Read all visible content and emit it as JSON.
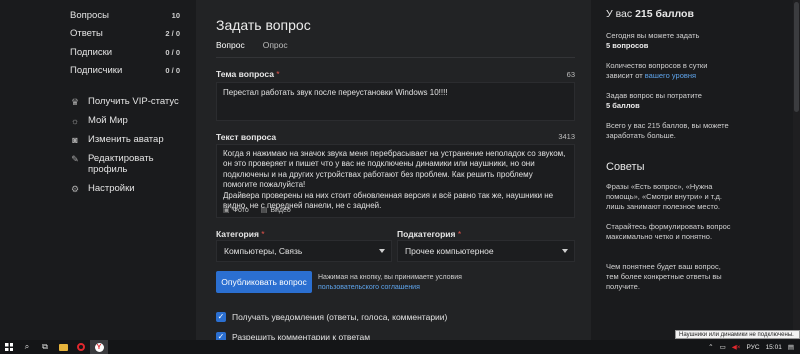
{
  "sidebar": {
    "stats": [
      {
        "label": "Вопросы",
        "count": "10"
      },
      {
        "label": "Ответы",
        "count": "2 / 0"
      },
      {
        "label": "Подписки",
        "count": "0 / 0"
      },
      {
        "label": "Подписчики",
        "count": "0 / 0"
      }
    ],
    "menu": [
      {
        "label": "Получить VIP-статус",
        "icon": "crown-icon"
      },
      {
        "label": "Мой Мир",
        "icon": "world-icon"
      },
      {
        "label": "Изменить аватар",
        "icon": "camera-icon"
      },
      {
        "label": "Редактировать профиль",
        "icon": "edit-icon"
      },
      {
        "label": "Настройки",
        "icon": "gear-icon"
      }
    ]
  },
  "form": {
    "title": "Задать вопрос",
    "tabs": [
      "Вопрос",
      "Опрос"
    ],
    "topic_label": "Тема вопроса",
    "topic_counter": "63",
    "topic_value": "Перестал работать звук после переустановки Windows 10!!!!",
    "question_label": "Текст вопроса",
    "question_counter": "3413",
    "question_value": "Когда я нажимаю на значок звука меня перебрасывает на устранение неполадок со звуком, он это проверяет и пишет что у вас не подключены динамики или наушники, но они подключены и на других устройствах работают без проблем. Как решить проблему помогите пожалуйста!\nДрайвера проверены на них стоит обновленная версия и всё равно так же, наушники не видно, не с передней панели, не с задней.",
    "attach_photo": "Фото",
    "attach_video": "Видео",
    "category_label": "Категория",
    "category_value": "Компьютеры, Связь",
    "subcategory_label": "Подкатегория",
    "subcategory_value": "Прочее компьютерное",
    "submit_label": "Опубликовать вопрос",
    "agree_text": "Нажимая на кнопку, вы принимаете условия",
    "agree_link": "пользовательского соглашения",
    "check_notify": "Получать уведомления (ответы, голоса, комментарии)",
    "check_comments": "Разрешить комментарии к ответам",
    "required_mark": "*"
  },
  "right": {
    "title_prefix": "У вас",
    "title_points": "215 баллов",
    "p1_text": "Сегодня вы можете задать",
    "p1_bold": "5 вопросов",
    "p2_text": "Количество вопросов в сутки зависит от",
    "p2_link": "вашего уровня",
    "p3_text": "Задав вопрос вы потратите",
    "p3_bold": "5 баллов",
    "p4_text": "Всего у вас 215 баллов, вы можете заработать больше.",
    "tips_title": "Советы",
    "tip1": "Фразы «Есть вопрос», «Нужна помощь», «Смотри внутри» и т.д. лишь занимают полезное место.",
    "tip2": "Старайтесь формулировать вопрос максимально четко и понятно.",
    "tip3": "Чем понятнее будет ваш вопрос, тем более конкретные ответы вы получите."
  },
  "tooltip": "Наушники или динамики не подключены.",
  "taskbar": {
    "lang": "РУС",
    "time": "15:01"
  },
  "colors": {
    "accent": "#2b6fd1",
    "link": "#5ea4ec",
    "required": "#e5524a"
  }
}
